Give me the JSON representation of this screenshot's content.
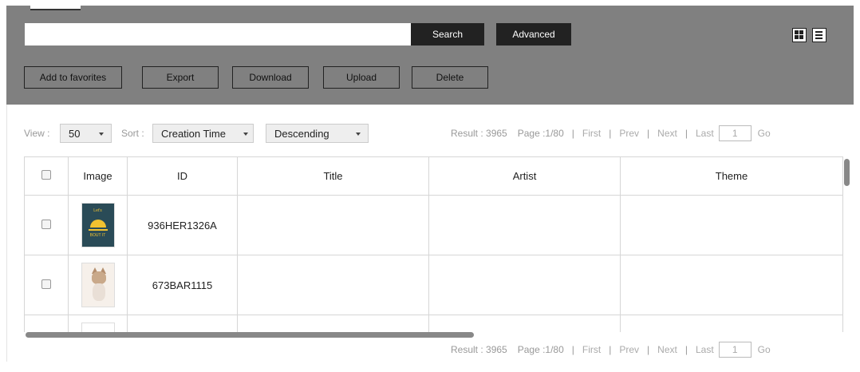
{
  "toolbar": {
    "search_placeholder": "",
    "search_label": "Search",
    "advanced_label": "Advanced",
    "actions": [
      "Add to favorites",
      "Export",
      "Download",
      "Upload",
      "Delete"
    ],
    "view_icons": [
      "grid-view-icon",
      "list-view-icon"
    ]
  },
  "controls": {
    "view_label": "View :",
    "view_value": "50",
    "sort_label": "Sort :",
    "sort_field": "Creation Time",
    "sort_order": "Descending"
  },
  "pager": {
    "result": "Result : 3965",
    "page": "Page :1/80",
    "first": "First",
    "prev": "Prev",
    "next": "Next",
    "last": "Last",
    "page_input": "1",
    "go": "Go",
    "separator": "|"
  },
  "table": {
    "headers": [
      "Image",
      "ID",
      "Title",
      "Artist",
      "Theme"
    ],
    "rows": [
      {
        "id": "936HER1326A",
        "title": "",
        "artist": "",
        "theme": "",
        "thumb_text_top": "Let's",
        "thumb_text_bottom": "BOUT IT"
      },
      {
        "id": "673BAR1115",
        "title": "",
        "artist": "",
        "theme": ""
      },
      {
        "id": "",
        "title": "",
        "artist": "",
        "theme": ""
      }
    ]
  }
}
